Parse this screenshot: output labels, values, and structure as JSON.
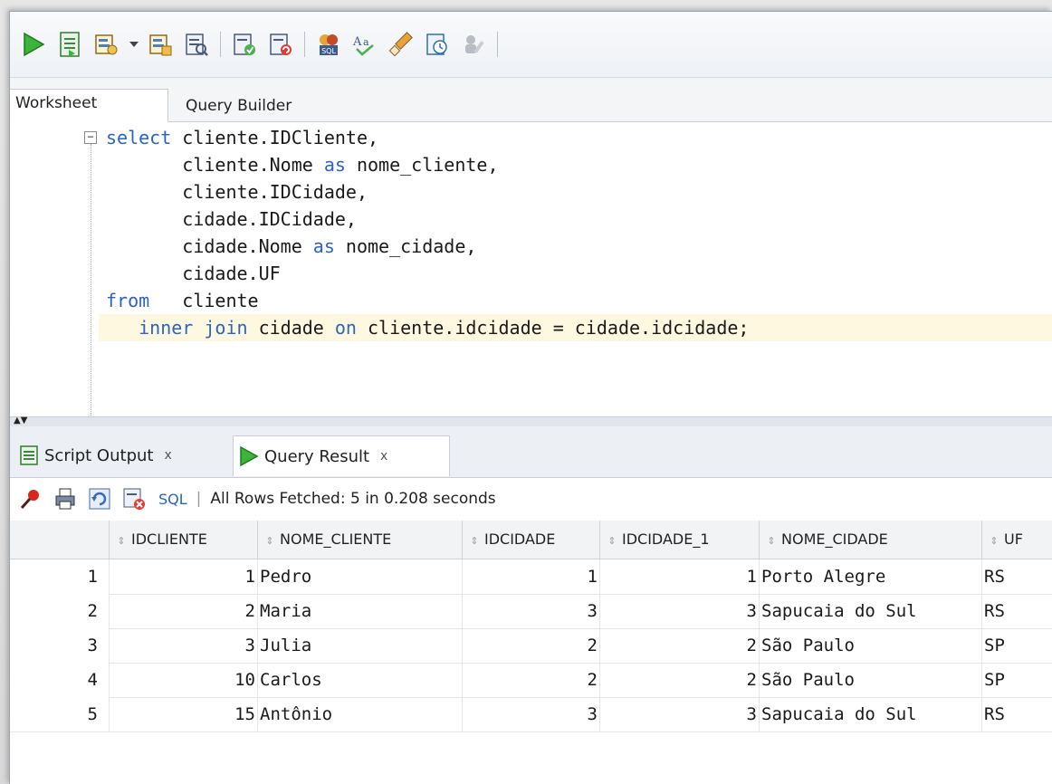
{
  "toolbar": {
    "icons": [
      "run-statement-icon",
      "run-script-icon",
      "autotrace-icon",
      "explain-plan-icon",
      "sql-tuning-icon",
      "commit-icon",
      "rollback-icon",
      "sql-worksheet-icon",
      "format-icon",
      "clear-icon",
      "history-icon",
      "unshared-icon"
    ]
  },
  "editor_tabs": {
    "worksheet": "Worksheet",
    "query_builder": "Query Builder"
  },
  "editor": {
    "lines": [
      {
        "kw": "select",
        "rest": " cliente.IDCliente,"
      },
      {
        "text": "       cliente.Nome ",
        "kw": "as",
        "rest": " nome_cliente,"
      },
      {
        "text": "       cliente.IDCidade,"
      },
      {
        "text": "       cidade.IDCidade,"
      },
      {
        "text": "       cidade.Nome ",
        "kw": "as",
        "rest": " nome_cidade,"
      },
      {
        "text": "       cidade.UF"
      },
      {
        "kw": "from",
        "rest": "   cliente"
      },
      {
        "text": "   ",
        "kw": "inner join",
        "rest": " cidade ",
        "kw2": "on",
        "rest2": " cliente.idcidade = cidade.idcidade;"
      }
    ]
  },
  "bottom_tabs": {
    "script_output": "Script Output",
    "query_result": "Query Result",
    "close": "x"
  },
  "results_toolbar": {
    "sql_label": "SQL",
    "separator": "|",
    "status": "All Rows Fetched: 5 in 0.208 seconds"
  },
  "grid": {
    "columns": [
      "IDCLIENTE",
      "NOME_CLIENTE",
      "IDCIDADE",
      "IDCIDADE_1",
      "NOME_CIDADE",
      "UF"
    ],
    "rows": [
      {
        "n": "1",
        "idcliente": "1",
        "nome_cliente": "Pedro",
        "idcidade": "1",
        "idcidade_1": "1",
        "nome_cidade": "Porto Alegre",
        "uf": "RS"
      },
      {
        "n": "2",
        "idcliente": "2",
        "nome_cliente": "Maria",
        "idcidade": "3",
        "idcidade_1": "3",
        "nome_cidade": "Sapucaia do Sul",
        "uf": "RS"
      },
      {
        "n": "3",
        "idcliente": "3",
        "nome_cliente": "Julia",
        "idcidade": "2",
        "idcidade_1": "2",
        "nome_cidade": "São Paulo",
        "uf": "SP"
      },
      {
        "n": "4",
        "idcliente": "10",
        "nome_cliente": "Carlos",
        "idcidade": "2",
        "idcidade_1": "2",
        "nome_cidade": "São Paulo",
        "uf": "SP"
      },
      {
        "n": "5",
        "idcliente": "15",
        "nome_cliente": "Antônio",
        "idcidade": "3",
        "idcidade_1": "3",
        "nome_cidade": "Sapucaia do Sul",
        "uf": "RS"
      }
    ]
  }
}
